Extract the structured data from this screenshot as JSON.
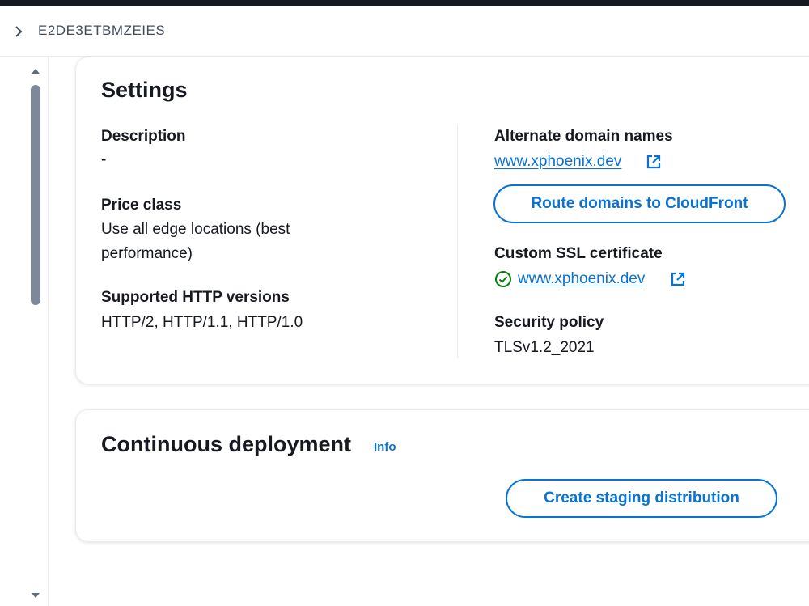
{
  "breadcrumb": {
    "distribution_id": "E2DE3ETBMZEIES"
  },
  "settings": {
    "title": "Settings",
    "description_label": "Description",
    "description_value": "-",
    "price_class_label": "Price class",
    "price_class_value_line1": "Use all edge locations (best",
    "price_class_value_line2": "performance)",
    "http_versions_label": "Supported HTTP versions",
    "http_versions_value": "HTTP/2, HTTP/1.1, HTTP/1.0",
    "alt_domains_label": "Alternate domain names",
    "alt_domain_link": "www.xphoenix.dev",
    "route_domains_button": "Route domains to CloudFront",
    "ssl_label": "Custom SSL certificate",
    "ssl_link": "www.xphoenix.dev",
    "security_policy_label": "Security policy",
    "security_policy_value": "TLSv1.2_2021"
  },
  "deployment": {
    "title": "Continuous deployment",
    "info_link": "Info",
    "create_staging_button": "Create staging distribution"
  },
  "icons": {
    "breadcrumb_chevron": "chevron-right-icon",
    "external_link": "external-link-icon",
    "status_success": "check-circle-icon"
  },
  "colors": {
    "link": "#0972d3",
    "success": "#037f0c",
    "text": "#16191f"
  }
}
